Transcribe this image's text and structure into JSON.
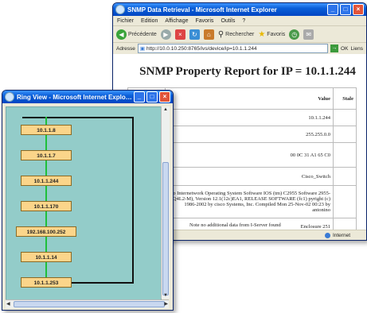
{
  "browser": {
    "title": "SNMP Data Retrieval - Microsoft Internet Explorer",
    "menu": [
      "Fichier",
      "Edition",
      "Affichage",
      "Favoris",
      "Outils",
      "?"
    ],
    "toolbar": {
      "back_label": "Précédente",
      "search_label": "Rechercher",
      "favorites_label": "Favoris"
    },
    "address": {
      "label": "Adresse",
      "url": "http://10.0.10.250:8765/ivs/device/ip=10.1.1.244",
      "go_label": "OK",
      "links_label": "Liens"
    },
    "report_title": "SNMP Property Report for IP = 10.1.1.244",
    "table": {
      "headers": [
        "",
        "Value",
        "Stale"
      ],
      "rows": [
        "10.1.1.244",
        "255.255.0.0",
        "00 0C 31 A1 65 C0",
        "Cisco_Switch",
        "co Internetwork Operating System Software IOS (tm) C2955 Software 2955-I9Q4L2-M), Version 12.1(12c)EA1, RELEASE SOFTWARE (fc1) pyright (c) 1986-2002 by cisco Systems, Inc. Compiled Mon 25-Nov-02 00:23 by antonino",
        "Enclosure 251"
      ]
    },
    "note": "Note no additional data from I-Server found",
    "status": "Internet"
  },
  "ring": {
    "title": "Ring View - Microsoft Internet Explorer",
    "nodes": [
      "10.1.1.8",
      "10.1.1.7",
      "10.1.1.244",
      "10.1.1.170",
      "192.168.100.252",
      "10.1.1.14",
      "10.1.1.253"
    ]
  },
  "colors": {
    "titlebar": "#0a5fd8",
    "ring_bg": "#93ccc9",
    "node_fill": "#fbd58a",
    "link_green": "#1fbf3a"
  }
}
